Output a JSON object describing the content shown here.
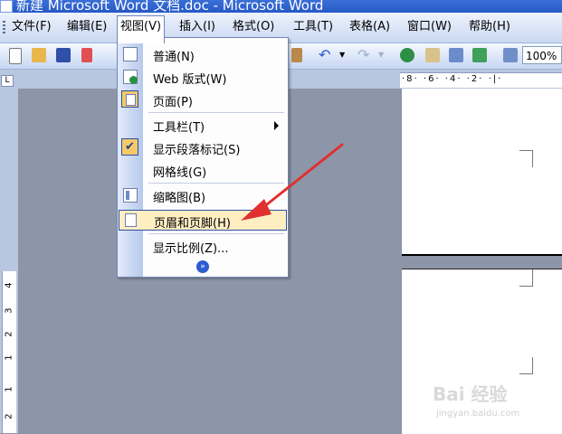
{
  "window": {
    "title": "新建 Microsoft Word 文档.doc - Microsoft Word"
  },
  "menubar": {
    "items": [
      "文件(F)",
      "编辑(E)",
      "视图(V)",
      "插入(I)",
      "格式(O)",
      "工具(T)",
      "表格(A)",
      "窗口(W)",
      "帮助(H)"
    ]
  },
  "toolbar": {
    "zoom": "100%"
  },
  "ruler": {
    "corner": "L",
    "h_ticks": "·8· ·6· ·4· ·2· ·|·",
    "v_ticks": [
      "4",
      "3",
      "2",
      "1",
      "1",
      "2"
    ]
  },
  "view_menu": {
    "items": [
      {
        "label": "普通(N)",
        "icon": "normal-view-icon"
      },
      {
        "label": "Web 版式(W)",
        "icon": "web-layout-icon"
      },
      {
        "label": "页面(P)",
        "icon": "page-layout-icon"
      },
      {
        "label": "工具栏(T)",
        "icon": "submenu-arrow"
      },
      {
        "label": "显示段落标记(S)",
        "icon": "check-icon"
      },
      {
        "label": "网格线(G)",
        "icon": ""
      },
      {
        "label": "缩略图(B)",
        "icon": "thumbnails-icon"
      },
      {
        "label": "页眉和页脚(H)",
        "icon": "header-footer-icon",
        "highlighted": true
      },
      {
        "label": "显示比例(Z)...",
        "icon": ""
      }
    ],
    "expand": "»"
  },
  "watermark": {
    "text": "Bai 经验",
    "sub": "jingyan.baidu.com"
  },
  "colors": {
    "highlight": "#ffeec2",
    "annotation": "#e03030",
    "menu_border": "#6f86b5"
  }
}
